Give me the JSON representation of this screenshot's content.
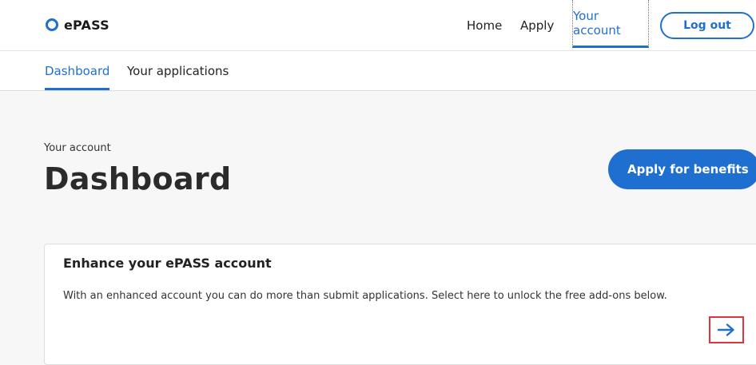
{
  "header": {
    "brand": "ePASS",
    "nav": {
      "home": "Home",
      "apply": "Apply",
      "account": "Your account"
    },
    "logout_label": "Log out"
  },
  "subnav": {
    "tabs": [
      "Dashboard",
      "Your applications"
    ]
  },
  "main": {
    "eyebrow": "Your account",
    "title": "Dashboard",
    "apply_button": "Apply for benefits"
  },
  "card": {
    "title": "Enhance your ePASS account",
    "description": "With an enhanced account you can do more than submit applications. Select here to unlock the free add-ons below.",
    "arrow_icon": "arrow-right-icon"
  },
  "colors": {
    "accent": "#1f6fd0",
    "highlight": "#e0353f"
  }
}
